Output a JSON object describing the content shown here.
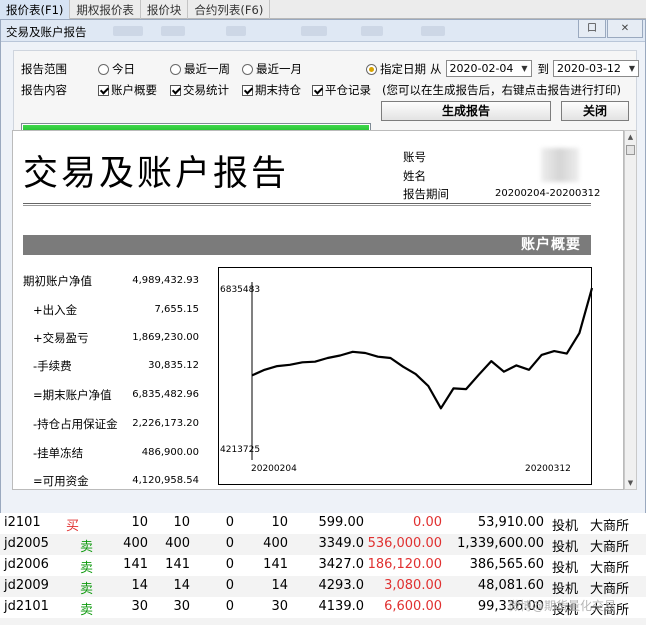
{
  "tabs": [
    "报价表(F1)",
    "期权报价表",
    "报价块",
    "合约列表(F6)"
  ],
  "dialog": {
    "title": "交易及账户报告",
    "win_buttons": [
      "口",
      "✕"
    ]
  },
  "controls": {
    "range_label": "报告范围",
    "content_label": "报告内容",
    "range_options": [
      {
        "label": "今日",
        "selected": false
      },
      {
        "label": "最近一周",
        "selected": false
      },
      {
        "label": "最近一月",
        "selected": false
      },
      {
        "label": "指定日期",
        "selected": true
      }
    ],
    "from_label": "从",
    "from_date": "2020-02-04",
    "to_label": "到",
    "to_date": "2020-03-12",
    "content_options": [
      "账户概要",
      "交易统计",
      "期末持仓",
      "平仓记录"
    ],
    "hint": "(您可以在生成报告后，右键点击报告进行打印)",
    "progress": 1.0,
    "generate_label": "生成报告",
    "close_label": "关闭"
  },
  "report": {
    "title": "交易及账户报告",
    "account_label": "账号",
    "name_label": "姓名",
    "period_label": "报告期间",
    "period_value": "20200204-20200312",
    "section_title": "账户概要",
    "summary": [
      {
        "label": "期初账户净值",
        "value": "4,989,432.93"
      },
      {
        "label": "+出入金",
        "value": "7,655.15"
      },
      {
        "label": "+交易盈亏",
        "value": "1,869,230.00"
      },
      {
        "label": "-手续费",
        "value": "30,835.12"
      },
      {
        "label": "=期末账户净值",
        "value": "6,835,482.96"
      },
      {
        "label": "-持仓占用保证金",
        "value": "2,226,173.20"
      },
      {
        "label": "-挂单冻结",
        "value": "486,900.00"
      },
      {
        "label": "=可用资金",
        "value": "4,120,958.54"
      }
    ]
  },
  "chart_data": {
    "type": "line",
    "y_top_label": "6835483",
    "y_bottom_label": "4213725",
    "x_start_label": "20200204",
    "x_end_label": "20200312",
    "ylim": [
      4213725,
      6835483
    ],
    "values": [
      5430000,
      5520000,
      5580000,
      5600000,
      5640000,
      5650000,
      5710000,
      5750000,
      5810000,
      5790000,
      5730000,
      5710000,
      5570000,
      5450000,
      5260000,
      4900000,
      5220000,
      5210000,
      5440000,
      5660000,
      5490000,
      5590000,
      5520000,
      5760000,
      5820000,
      5780000,
      6110000,
      6835483
    ]
  },
  "table": {
    "rows": [
      {
        "code": "i2101",
        "side": "买",
        "qty": "10",
        "q2": "10",
        "q3": "0",
        "q4": "10",
        "price": "599.00",
        "pnl": "0.00",
        "amount": "53,910.00",
        "type": "投机",
        "exchange": "大商所"
      },
      {
        "code": "jd2005",
        "side": "卖",
        "qty": "400",
        "q2": "400",
        "q3": "0",
        "q4": "400",
        "price": "3349.0",
        "pnl": "536,000.00",
        "amount": "1,339,600.00",
        "type": "投机",
        "exchange": "大商所"
      },
      {
        "code": "jd2006",
        "side": "卖",
        "qty": "141",
        "q2": "141",
        "q3": "0",
        "q4": "141",
        "price": "3427.0",
        "pnl": "186,120.00",
        "amount": "386,565.60",
        "type": "投机",
        "exchange": "大商所"
      },
      {
        "code": "jd2009",
        "side": "卖",
        "qty": "14",
        "q2": "14",
        "q3": "0",
        "q4": "14",
        "price": "4293.0",
        "pnl": "3,080.00",
        "amount": "48,081.60",
        "type": "投机",
        "exchange": "大商所"
      },
      {
        "code": "jd2101",
        "side": "卖",
        "qty": "30",
        "q2": "30",
        "q3": "0",
        "q4": "30",
        "price": "4139.0",
        "pnl": "6,600.00",
        "amount": "99,336.00",
        "type": "投机",
        "exchange": "大商所"
      }
    ]
  }
}
